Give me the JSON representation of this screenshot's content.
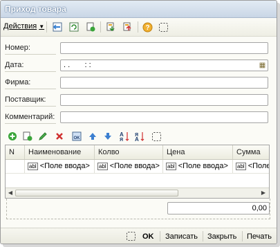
{
  "window": {
    "title": "Приход товара"
  },
  "toolbar": {
    "actions_label": "Действия",
    "icons": [
      "save-icon",
      "refresh-icon",
      "copy-icon",
      "post-down-icon",
      "post-up-icon",
      "help-icon",
      "dotted-frame-icon"
    ]
  },
  "form": {
    "fields": [
      {
        "label": "Номер:",
        "value": ""
      },
      {
        "label": "Дата:",
        "value": ". .       : :"
      },
      {
        "label": "Фирма:",
        "value": ""
      },
      {
        "label": "Поставщик:",
        "value": ""
      },
      {
        "label": "Комментарий:",
        "value": ""
      }
    ]
  },
  "table": {
    "columns": [
      "N",
      "Наименование",
      "Колво",
      "Цена",
      "Сумма"
    ],
    "row": {
      "n": "",
      "name": "<Поле ввода>",
      "qty": "<Поле ввода>",
      "price": "<Поле ввода>",
      "sum": "<Поле ввода>"
    },
    "field_badge": "abl"
  },
  "total": {
    "value": "0,00"
  },
  "footer": {
    "ok": "OK",
    "save": "Записать",
    "close": "Закрыть",
    "print": "Печать"
  },
  "colors": {
    "title_bg": "#c9d6e6",
    "window_bg": "#fbfbf6",
    "add_green": "#3aa53a",
    "delete_red": "#d03030",
    "arrow_blue": "#3c7fd0"
  }
}
